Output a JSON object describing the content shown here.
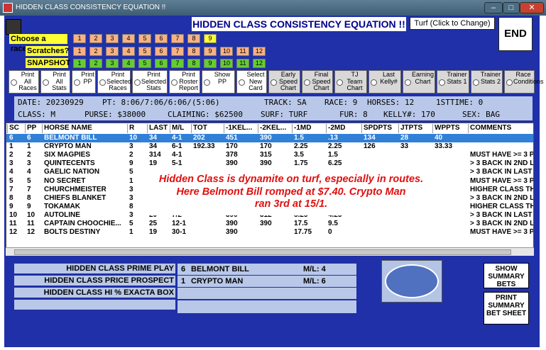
{
  "window": {
    "title": "HIDDEN CLASS CONSISTENCY EQUATION !!"
  },
  "header": {
    "title": "HIDDEN CLASS CONSISTENCY EQUATION !!",
    "surface_button": "Turf (Click to Change)",
    "end_button": "END"
  },
  "race_row": {
    "label": "Choose  a race:",
    "buttons": [
      "1",
      "2",
      "3",
      "4",
      "5",
      "6",
      "7",
      "8",
      "9"
    ]
  },
  "scratch_row": {
    "label": "Scratches?",
    "buttons": [
      "1",
      "2",
      "3",
      "4",
      "5",
      "6",
      "7",
      "8",
      "9",
      "10",
      "11",
      "12"
    ]
  },
  "snapshot_row": {
    "label": "SNAPSHOT",
    "buttons": [
      "1",
      "2",
      "3",
      "4",
      "5",
      "6",
      "7",
      "8",
      "9",
      "10",
      "11",
      "12"
    ]
  },
  "options": [
    {
      "label": "Print All Races",
      "type": "white"
    },
    {
      "label": "Print All Stats",
      "type": "white"
    },
    {
      "label": "Print PP",
      "type": "white"
    },
    {
      "label": "Print Selected Races",
      "type": "white"
    },
    {
      "label": "Print Selected Stats",
      "type": "white"
    },
    {
      "label": "Print Roster Report",
      "type": "white"
    },
    {
      "label": "Show PP",
      "type": "white"
    },
    {
      "label": "Select New Card",
      "type": "white"
    },
    {
      "label": "Early Speed Chart",
      "type": "grey"
    },
    {
      "label": "Final Speed Chart",
      "type": "grey"
    },
    {
      "label": "TJ Team Chart",
      "type": "grey"
    },
    {
      "label": "Last Kelly#",
      "type": "grey"
    },
    {
      "label": "Earning Chart",
      "type": "grey"
    },
    {
      "label": "Trainer Stats 1",
      "type": "grey"
    },
    {
      "label": "Trainer Stats 2",
      "type": "grey"
    },
    {
      "label": "Race Conditions",
      "type": "grey"
    }
  ],
  "info1": {
    "date": "DATE: 20230929",
    "pt": "PT: 8:06/7:06/6:06/(5:06)",
    "track": "TRACK: SA",
    "race": "RACE: 9",
    "horses": "HORSES: 12",
    "firsttime": "1STTIME:  0"
  },
  "info2": {
    "cls": "CLASS: M",
    "purse": "PURSE: $38000",
    "claiming": "CLAIMING: $62500",
    "surf": "SURF: TURF",
    "fur": "FUR: 8",
    "kelly": "KELLY#: 170",
    "sex": "SEX: BAG"
  },
  "grid": {
    "columns": [
      "SC",
      "PP",
      "HORSE NAME",
      "R",
      "LAST",
      "M/L",
      "TOT",
      "-1KEL...",
      "-2KEL...",
      "-1MD",
      "-2MD",
      "SPDPTS",
      "JTPTS",
      "WPPTS",
      "COMMENTS"
    ],
    "rows": [
      [
        "6",
        "6",
        "BELMONT BILL",
        "10",
        "34",
        "4-1",
        "202",
        "451",
        "390",
        "1.5",
        ".13",
        "134",
        "28",
        "40",
        ""
      ],
      [
        "1",
        "1",
        "CRYPTO MAN",
        "3",
        "34",
        "6-1",
        "192.33",
        "170",
        "170",
        "2.25",
        "2.25",
        "126",
        "33",
        "33.33",
        ""
      ],
      [
        "2",
        "2",
        "SIX MAGPIES",
        "2",
        "314",
        "4-1",
        "",
        "378",
        "315",
        "3.5",
        "1.5",
        "",
        "",
        "",
        "MUST HAVE >= 3 PL"
      ],
      [
        "3",
        "3",
        "QUINTECENTS",
        "9",
        "19",
        "5-1",
        "",
        "390",
        "390",
        "1.75",
        "6.25",
        "",
        "",
        "",
        "> 3 BACK IN 2ND LA"
      ],
      [
        "4",
        "4",
        "GAELIC NATION",
        "5",
        "",
        "",
        "",
        "",
        "",
        "",
        "",
        "",
        "",
        "",
        "> 3 BACK IN LAST"
      ],
      [
        "5",
        "5",
        "NO SECRET",
        "1",
        "",
        "",
        "",
        "",
        "",
        "",
        "",
        "",
        "",
        "",
        "MUST HAVE >= 3 PL"
      ],
      [
        "7",
        "7",
        "CHURCHMEISTER",
        "3",
        "",
        "",
        "",
        "",
        "",
        "",
        "",
        "",
        "",
        "",
        "HIGHER CLASS THA"
      ],
      [
        "8",
        "8",
        "CHIEFS BLANKET",
        "3",
        "",
        "",
        "",
        "",
        "",
        "",
        "",
        "",
        "",
        "",
        "> 3 BACK IN 2ND LA"
      ],
      [
        "9",
        "9",
        "TOKAMAK",
        "8",
        "",
        "",
        "",
        "",
        "",
        "",
        "",
        "",
        "",
        "",
        "HIGHER CLASS THA"
      ],
      [
        "10",
        "10",
        "AUTOLINE",
        "3",
        "20",
        "7/2",
        "",
        "390",
        "312",
        "5.25",
        "4.25",
        "",
        "",
        "",
        "> 3 BACK IN LAST"
      ],
      [
        "11",
        "11",
        "CAPTAIN CHOOCHIE...",
        "5",
        "25",
        "12-1",
        "",
        "390",
        "390",
        "17.5",
        "9.5",
        "",
        "",
        "",
        "> 3 BACK IN 2ND LA"
      ],
      [
        "12",
        "12",
        "BOLTS DESTINY",
        "1",
        "19",
        "30-1",
        "",
        "390",
        "",
        "17.75",
        "0",
        "",
        "",
        "",
        "MUST HAVE >= 3 PL"
      ]
    ]
  },
  "popup": {
    "line1": "Hidden Class is dynamite on turf, especially in routes.",
    "line2": "Here Belmont Bill romped at $7.40.  Crypto Man",
    "line3": "ran 3rd at 15/1."
  },
  "bottom": {
    "labels": [
      "HIDDEN CLASS PRIME PLAY",
      "HIDDEN CLASS PRICE PROSPECT",
      "HIDDEN CLASS HI % EXACTA BOX",
      ""
    ],
    "picks": [
      {
        "num": "6",
        "name": "BELMONT BILL",
        "ml": "M/L:  4"
      },
      {
        "num": "1",
        "name": "CRYPTO MAN",
        "ml": "M/L:  6"
      }
    ],
    "show_summary": "SHOW SUMMARY BETS",
    "print_summary": "PRINT SUMMARY BET SHEET"
  },
  "colors": {
    "panel": "#2030a8",
    "info": "#b9c8e8",
    "race_btn": "#f8b184",
    "snap_btn": "#66cc33",
    "label_yellow": "#ffff33",
    "popup_text": "#e01010",
    "selected_row": "#3080d8"
  }
}
